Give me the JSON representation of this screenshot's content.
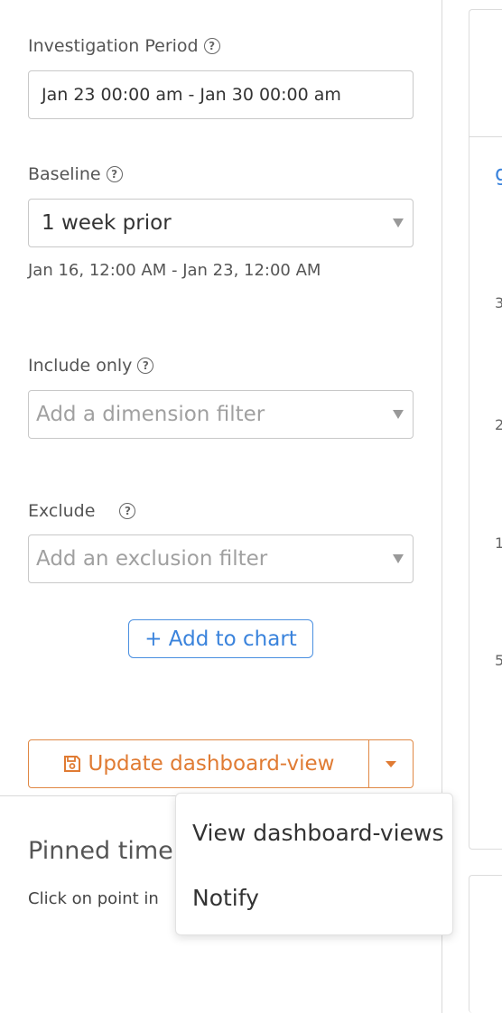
{
  "investigation": {
    "label": "Investigation Period",
    "value": "Jan 23 00:00 am - Jan 30 00:00 am"
  },
  "baseline": {
    "label": "Baseline",
    "selected": "1 week prior",
    "range": "Jan 16, 12:00 AM - Jan 23, 12:00 AM"
  },
  "include_only": {
    "label": "Include only",
    "placeholder": "Add a dimension filter"
  },
  "exclude": {
    "label": "Exclude",
    "placeholder": "Add an exclusion filter"
  },
  "add_to_chart": "+ Add to chart",
  "update_button": {
    "label": "Update dashboard-view",
    "icon": "floppy-disk-icon",
    "color": "#e07b33"
  },
  "dropdown_menu": {
    "items": [
      "View dashboard-views",
      "Notify"
    ]
  },
  "pinned": {
    "title": "Pinned time",
    "hint": "Click on point in"
  },
  "right_panel": {
    "link_fragment": "g",
    "ticks": [
      "3",
      "2",
      "1",
      "5"
    ]
  },
  "colors": {
    "accent_blue": "#3a83dc",
    "accent_orange": "#e07b33"
  }
}
